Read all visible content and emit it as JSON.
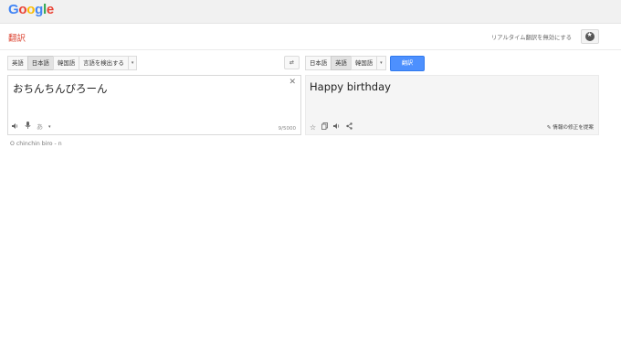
{
  "header": {
    "logo_letters": [
      {
        "ch": "G",
        "color": "#4285f4"
      },
      {
        "ch": "o",
        "color": "#ea4335"
      },
      {
        "ch": "o",
        "color": "#fbbc05"
      },
      {
        "ch": "g",
        "color": "#4285f4"
      },
      {
        "ch": "l",
        "color": "#34a853"
      },
      {
        "ch": "e",
        "color": "#ea4335"
      }
    ],
    "app_title": "翻訳",
    "instant_toggle": "リアルタイム翻訳を無効にする",
    "settings_icon": "star-circle-icon"
  },
  "source": {
    "langs": [
      "英語",
      "日本語",
      "韓国語",
      "言語を検出する"
    ],
    "selected": "日本語",
    "text": "おちんちんびろーん",
    "char_count": "9/5000",
    "input_tool": "あ",
    "transliteration": "O chinchin biro - n"
  },
  "target": {
    "langs": [
      "日本語",
      "英語",
      "韓国語"
    ],
    "selected": "英語",
    "translate_button": "翻訳",
    "text": "Happy birthday",
    "suggest_edit": "情報の修正を提案"
  },
  "colors": {
    "title_red": "#dd4b39",
    "button_blue": "#4d90fe"
  }
}
